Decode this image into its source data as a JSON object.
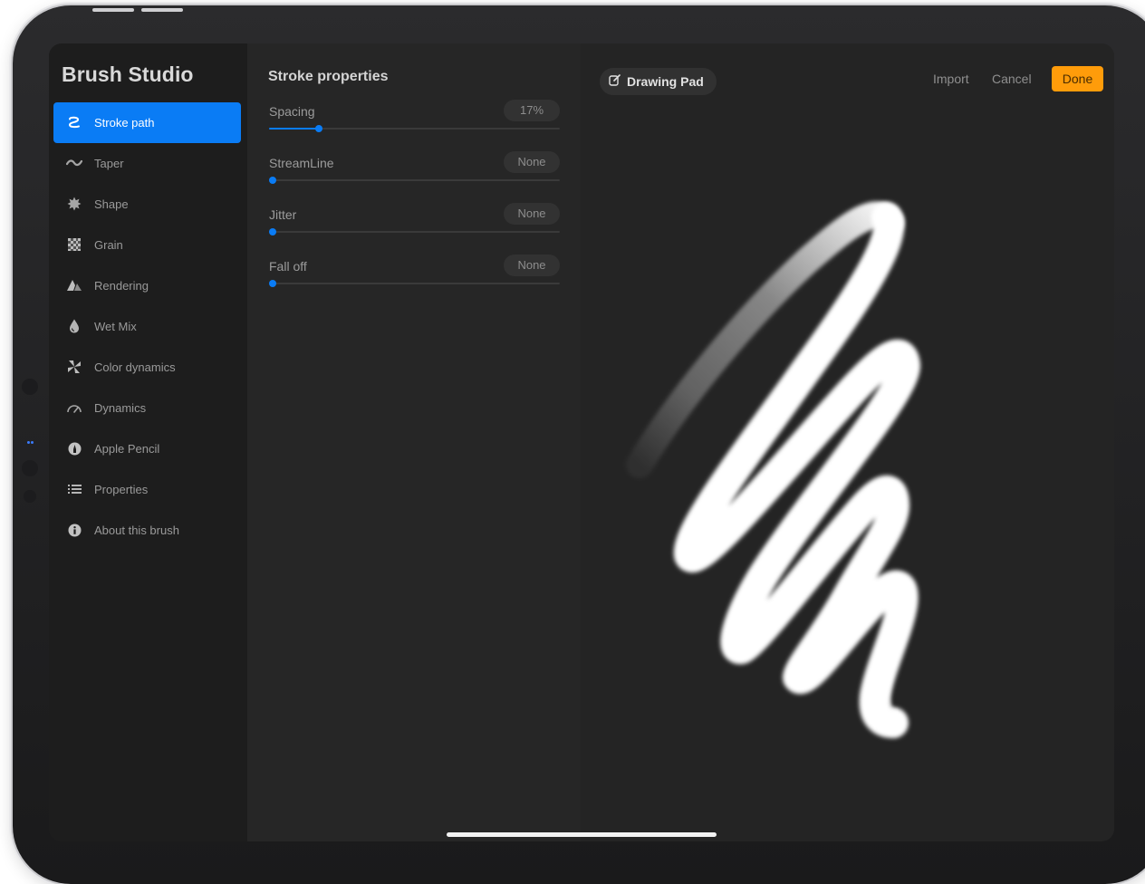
{
  "sidebar": {
    "title": "Brush Studio",
    "items": [
      {
        "label": "Stroke path",
        "icon": "stroke-path-icon",
        "active": true
      },
      {
        "label": "Taper",
        "icon": "taper-icon",
        "active": false
      },
      {
        "label": "Shape",
        "icon": "shape-icon",
        "active": false
      },
      {
        "label": "Grain",
        "icon": "grain-icon",
        "active": false
      },
      {
        "label": "Rendering",
        "icon": "rendering-icon",
        "active": false
      },
      {
        "label": "Wet Mix",
        "icon": "wet-mix-icon",
        "active": false
      },
      {
        "label": "Color dynamics",
        "icon": "color-dynamics-icon",
        "active": false
      },
      {
        "label": "Dynamics",
        "icon": "dynamics-icon",
        "active": false
      },
      {
        "label": "Apple Pencil",
        "icon": "apple-pencil-icon",
        "active": false
      },
      {
        "label": "Properties",
        "icon": "properties-icon",
        "active": false
      },
      {
        "label": "About this brush",
        "icon": "info-icon",
        "active": false
      }
    ]
  },
  "stroke_properties": {
    "title": "Stroke properties",
    "sliders": [
      {
        "label": "Spacing",
        "value": "17%",
        "level": 0.17
      },
      {
        "label": "StreamLine",
        "value": "None",
        "level": 0
      },
      {
        "label": "Jitter",
        "value": "None",
        "level": 0
      },
      {
        "label": "Fall off",
        "value": "None",
        "level": 0
      }
    ]
  },
  "toolbar": {
    "drawing_pad_label": "Drawing Pad",
    "import_label": "Import",
    "cancel_label": "Cancel",
    "done_label": "Done"
  },
  "colors": {
    "accent": "#0a7cf5",
    "done": "#ff9c0a"
  }
}
